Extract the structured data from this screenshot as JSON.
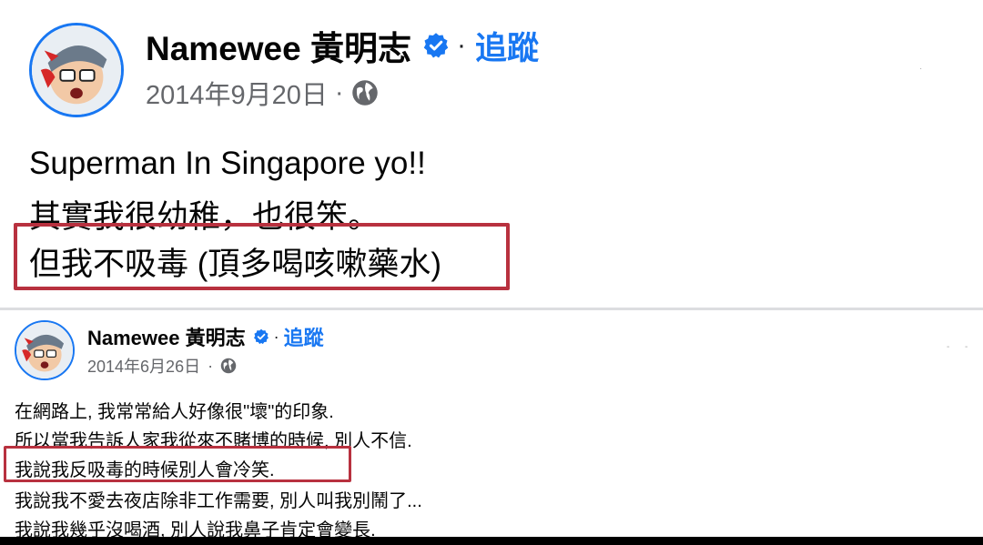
{
  "posts": [
    {
      "author": "Namewee 黃明志",
      "follow_label": "追蹤",
      "separator": "·",
      "date": "2014年9月20日",
      "privacy_icon": "globe-icon",
      "lines": [
        "Superman In Singapore yo!!",
        "其實我很幼稚，也很笨。",
        "但我不吸毒 (頂多喝咳嗽藥水)"
      ],
      "highlighted_line_index": 2
    },
    {
      "author": "Namewee 黃明志",
      "follow_label": "追蹤",
      "separator": "·",
      "date": "2014年6月26日",
      "privacy_icon": "globe-icon",
      "lines": [
        "在網路上, 我常常給人好像很\"壞\"的印象.",
        "所以當我告訴人家我從來不賭博的時候, 別人不信.",
        "我說我反吸毒的時候別人會冷笑.",
        "我說我不愛去夜店除非工作需要, 別人叫我別鬧了...",
        "我說我幾乎沒喝酒, 別人說我鼻子肯定會變長."
      ],
      "highlighted_line_index": 2
    }
  ],
  "colors": {
    "accent": "#1877f2",
    "highlight_border": "#b8313f",
    "secondary_text": "#65676b"
  }
}
